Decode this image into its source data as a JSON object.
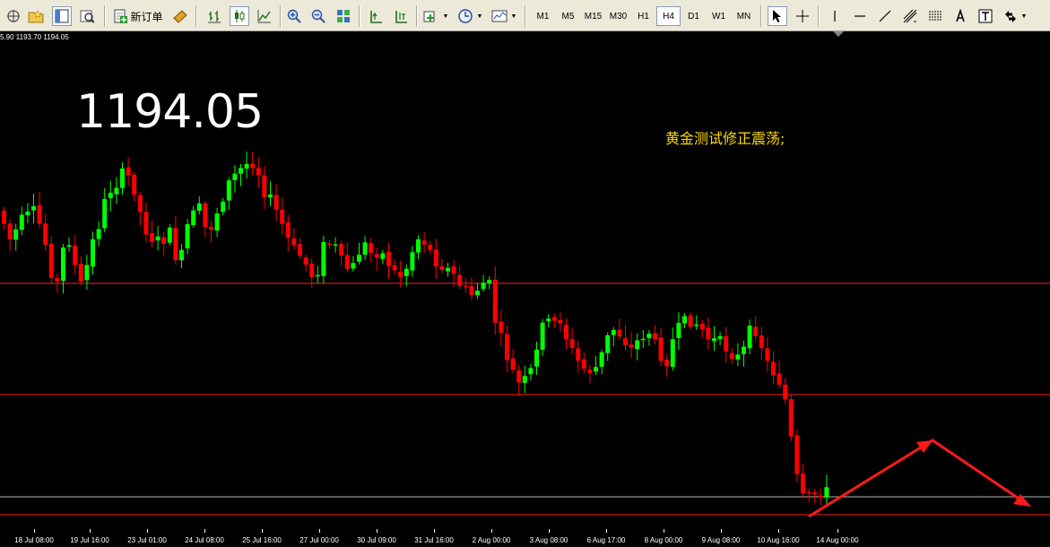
{
  "toolbar": {
    "new_order_label": "新订单",
    "timeframes": [
      "M1",
      "M5",
      "M15",
      "M30",
      "H1",
      "H4",
      "D1",
      "W1",
      "MN"
    ],
    "active_timeframe": "H4"
  },
  "chart": {
    "ohlc_text": "5.90 1193.70 1194.05",
    "big_price": "1194.05",
    "annotation": "黄金测试修正震荡;",
    "colors": {
      "background": "#000000",
      "bull": "#00ff00",
      "bear": "#ff0000",
      "hline": "#ff2020",
      "bid_line": "#b4b4b4",
      "arrow": "#ff1a1a",
      "price_text": "#ffffff",
      "annotation_text": "#ffd700"
    },
    "x_labels": [
      "18 Jul 08:00",
      "19 Jul 16:00",
      "23 Jul 01:00",
      "24 Jul 08:00",
      "25 Jul 16:00",
      "27 Jul 00:00",
      "30 Jul 09:00",
      "31 Jul 16:00",
      "2 Aug 00:00",
      "3 Aug 08:00",
      "6 Aug 17:00",
      "8 Aug 00:00",
      "9 Aug 08:00",
      "10 Aug 16:00",
      "14 Aug 00:00"
    ]
  }
}
